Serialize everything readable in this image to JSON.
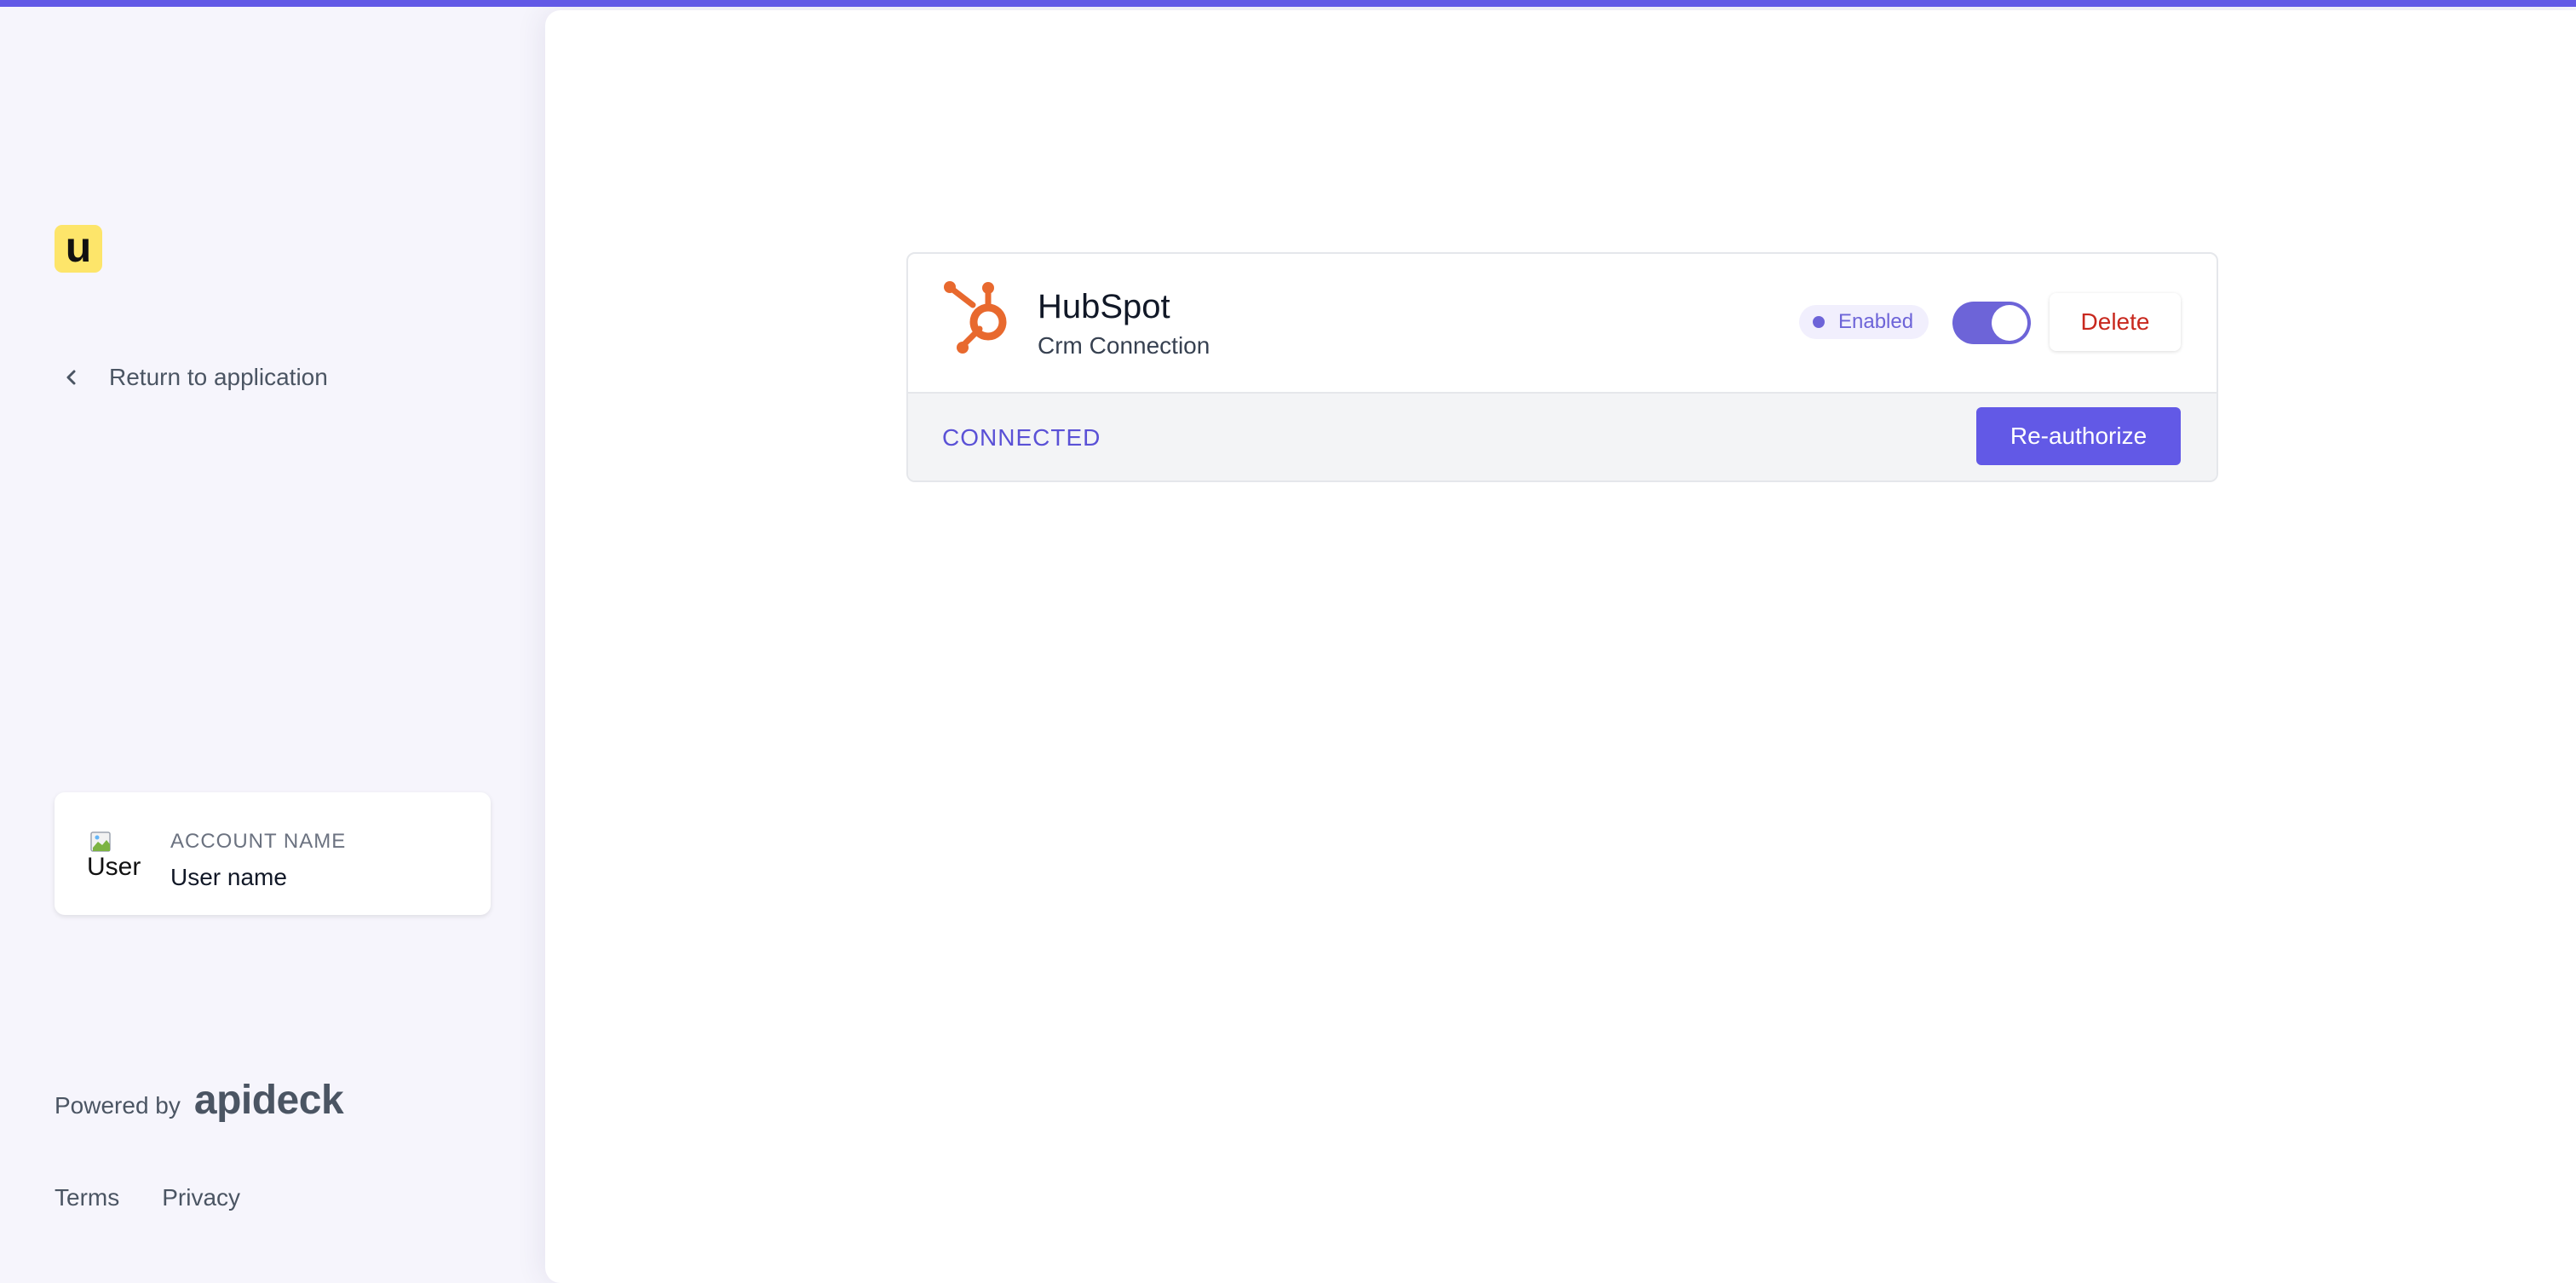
{
  "sidebar": {
    "logo_letter": "u",
    "return_label": "Return to application",
    "account": {
      "label": "ACCOUNT NAME",
      "user_name": "User name",
      "avatar_alt": "User"
    },
    "powered_by": "Powered by",
    "brand": "apideck",
    "links": {
      "terms": "Terms",
      "privacy": "Privacy"
    }
  },
  "connection": {
    "name": "HubSpot",
    "subtitle": "Crm Connection",
    "badge": "Enabled",
    "toggle_on": true,
    "delete_label": "Delete",
    "status": "CONNECTED",
    "reauthorize_label": "Re-authorize",
    "icon": "hubspot-logo"
  },
  "colors": {
    "accent": "#6259e6",
    "logo_bg": "#fde56a",
    "hubspot_orange": "#e8692e",
    "delete_red": "#c8281e",
    "status_text": "#5a51d6"
  }
}
